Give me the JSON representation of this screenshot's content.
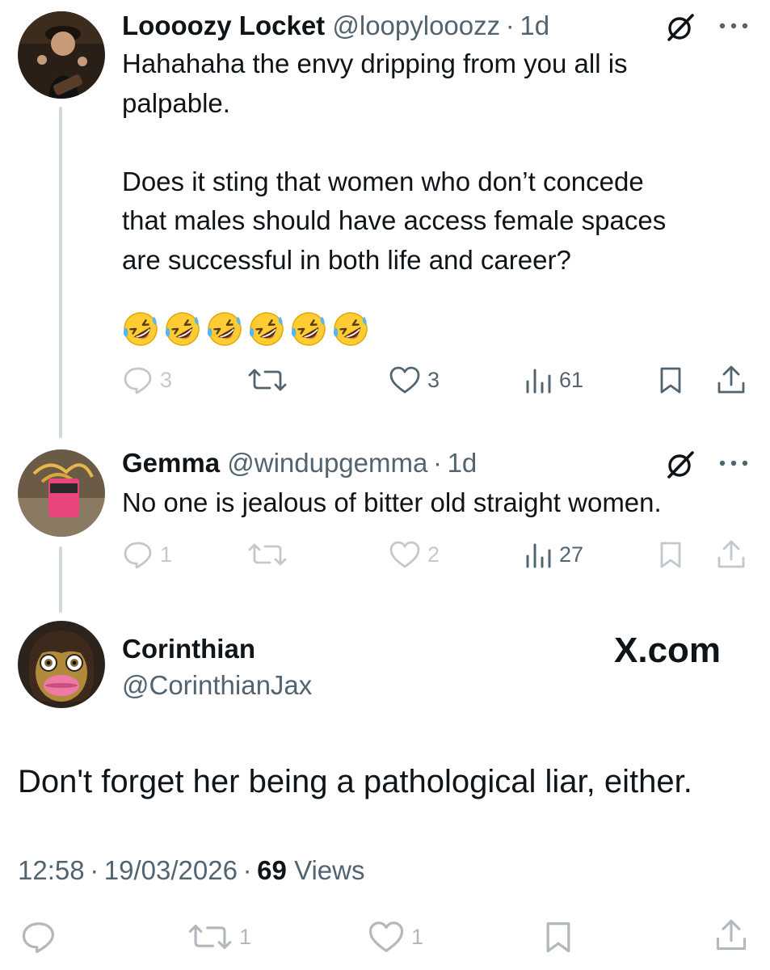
{
  "tweet1": {
    "display_name": "Loooozy Locket",
    "handle": "@loopylooozz",
    "time": "1d",
    "lines": [
      "Hahahaha the envy dripping from you all is",
      "palpable.",
      "",
      "Does it sting that women who don’t concede",
      "that males should have access female spaces",
      "are successful in both life and career?"
    ],
    "emoji": [
      "rolling-on-floor-laughing",
      "rolling-on-floor-laughing",
      "rolling-on-floor-laughing",
      "rolling-on-floor-laughing",
      "rolling-on-floor-laughing",
      "rolling-on-floor-laughing"
    ],
    "replies": "3",
    "reposts": "",
    "likes": "3",
    "views": "61"
  },
  "tweet2": {
    "display_name": "Gemma",
    "handle": "@windupgemma",
    "time": "1d",
    "text": "No one is jealous of bitter old straight women.",
    "replies": "1",
    "reposts": "",
    "likes": "2",
    "views": "27"
  },
  "main_tweet": {
    "display_name": "Corinthian",
    "handle": "@CorinthianJax",
    "watermark": "X.com",
    "text": "Don't forget her being a pathological liar, either.",
    "time": "12:58",
    "date": "19/03/2026",
    "views_count": "69",
    "views_label": "Views",
    "replies": "",
    "reposts": "1",
    "likes": "1"
  },
  "separator": "·",
  "icons": {
    "reply": "reply-icon",
    "repost": "repost-icon",
    "like": "heart-icon",
    "views": "views-icon",
    "bookmark": "bookmark-icon",
    "share": "share-icon",
    "grok": "grok-icon",
    "more": "more-icon"
  },
  "colors": {
    "text": "#0f1419",
    "secondary": "#536471",
    "thread_line": "#cfd9de"
  }
}
